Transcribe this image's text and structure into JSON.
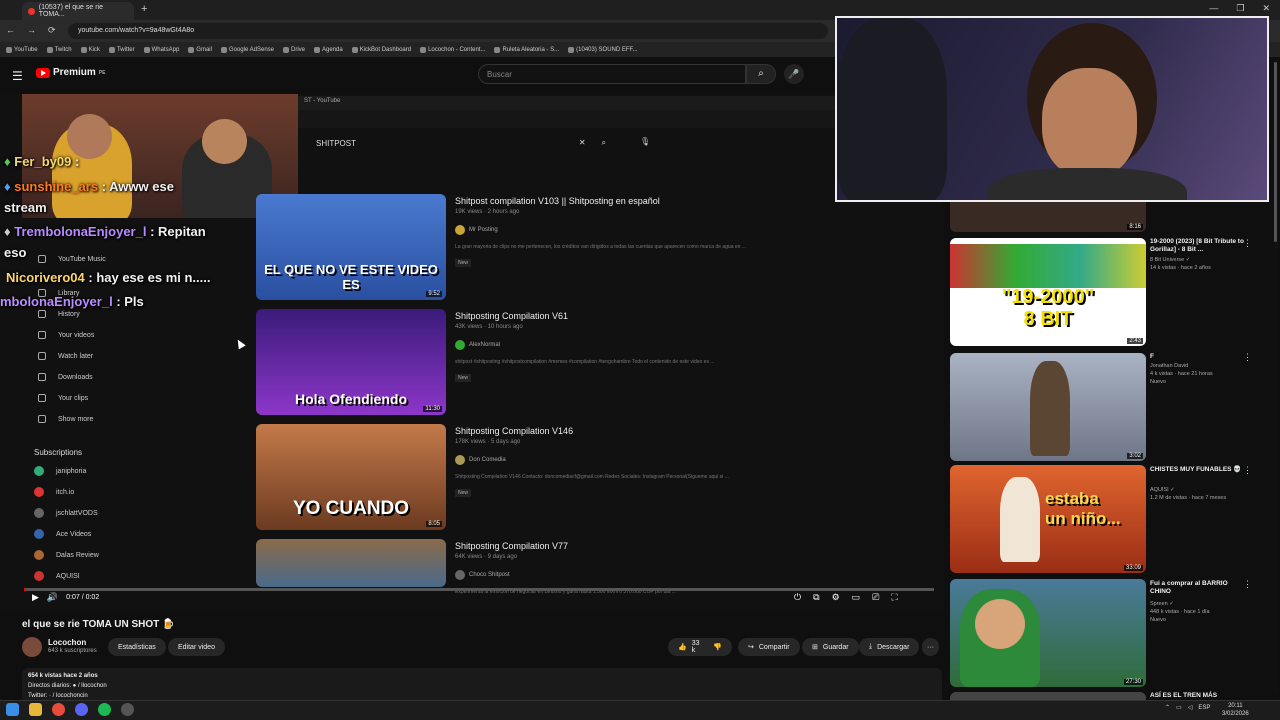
{
  "browser": {
    "tab_title": "(10537) el que se rie TOMA...",
    "new_tab": "+",
    "window_controls": [
      "—",
      "❐",
      "✕"
    ],
    "nav": [
      "←",
      "→",
      "⟳"
    ],
    "url": "youtube.com/watch?v=9a48wGt4A8o",
    "bookmarks": [
      "YouTube",
      "Twitch",
      "Kick",
      "Twitter",
      "WhatsApp",
      "Gmail",
      "Google AdSense",
      "Drive",
      "Agenda",
      "KickBot Dashboard",
      "Locochon - Content...",
      "Ruleta Aleatoria - S...",
      "(10403) SOUND EFF..."
    ]
  },
  "youtube": {
    "menu_icon": "☰",
    "logo": "Premium",
    "logo_sup": "PE",
    "search_placeholder": "Buscar",
    "search_icon": "⌕",
    "mic_icon": "🎤"
  },
  "inner": {
    "tab": "ST - YouTube",
    "search_query": "SHITPOST",
    "search_clear": "✕",
    "search_icon": "⌕",
    "mic_icon": "🎙",
    "menu_items": [
      "YouTube Music",
      "Library",
      "History",
      "Your videos",
      "Watch later",
      "Downloads",
      "Your clips",
      "Show more"
    ],
    "subs_header": "Subscriptions",
    "subs": [
      "janiphoria",
      "itch.io",
      "jschlattVODS",
      "Ace Videos",
      "Dalas Review",
      "AQUISI"
    ],
    "results": [
      {
        "title": "Shitpost compilation V103 || Shitposting en español",
        "meta": "19K views · 2 hours ago",
        "channel": "Mr Posting",
        "desc": "La gran mayoria de clips no me pertenecen, los créditos van dirigidos a todas las cuentas que aparecen como marca de agua en ...",
        "badge": "New",
        "thumb_text": "EL QUE NO VE ESTE VIDEO ES",
        "duration": "9:52"
      },
      {
        "title": "Shitposting Compilation V61",
        "meta": "43K views · 10 hours ago",
        "channel": "AlexNormal",
        "desc": "shitpost #shitposting #shitpostcompilation #memes #compilation #tengohambre Todo el contenido de este video es ...",
        "badge": "New",
        "thumb_text": "Hola Ofendiendo",
        "duration": "11:30"
      },
      {
        "title": "Shitposting Compilation V146",
        "meta": "178K views · 5 days ago",
        "channel": "Don Comedia",
        "desc": "Shitposting Compilation V146 Contacto: doncomediacf@gmail.com Redes Sociales: Instagram Personal(Sigueme aqui si ...",
        "badge": "New",
        "thumb_text": "YO CUANDO",
        "duration": "8:05"
      },
      {
        "title": "Shitposting Compilation V77",
        "meta": "64K views · 9 days ago",
        "channel": "Choco Shitpost",
        "desc": "Experimenta la emoción de negociar en Binomo y gana hasta 1.500 MXN o 370.000 COP por dia ...",
        "badge": "",
        "thumb_text": "",
        "duration": ""
      }
    ]
  },
  "chat": [
    {
      "user": "Fer_by09",
      "msg": " : ",
      "color": "#f5d76e"
    },
    {
      "user": "sunshine_ars",
      "msg": " : Awww ese",
      "color": "#ff7a1a"
    },
    {
      "user": "",
      "msg": "stream",
      "color": "#ffffff"
    },
    {
      "user": "TrembolonaEnjoyer_l",
      "msg": " : Repitan",
      "color": "#b98cff"
    },
    {
      "user": "",
      "msg": "eso",
      "color": "#ffffff"
    },
    {
      "user": "Nicorivero04",
      "msg": " : hay ese es mi n.....",
      "color": "#ffd56b"
    },
    {
      "user": "mbolonaEnjoyer_l",
      "msg": " : Pls",
      "color": "#b98cff"
    }
  ],
  "player": {
    "progress": 0.0,
    "time": "0:07 / 0:02",
    "play_icon": "▶",
    "volume_icon": "🔊",
    "right_icons": [
      "⏻",
      "⧉",
      "⚙",
      "▭",
      "⎚",
      "⛶"
    ]
  },
  "video": {
    "title": "el que se rie TOMA UN SHOT 🍺",
    "channel": "Locochon",
    "subs": "643 k suscriptores",
    "btn_stats": "Estadísticas",
    "btn_edit": "Editar video",
    "likes": "33 k",
    "share": "Compartir",
    "save": "Guardar",
    "download": "Descargar",
    "more": "···",
    "desc_line1": "654 k vistas  hace 2 años",
    "desc_line2": "Directos diarios: ● / llocochon",
    "desc_line3": "Twitter: · / locochoncin"
  },
  "sidebar": [
    {
      "title": "",
      "meta": "",
      "duration": "8:16",
      "color": "#3a2a24"
    },
    {
      "title": "19-2000 (2023) [8 Bit Tribute to Gorillaz] - 8 Bit ...",
      "meta": "8 Bit Universe ✓\n14 k vistas · hace 2 años",
      "duration": "2:43",
      "thumb_text": "\"19-2000\"\n8 BIT",
      "color": "#ffffff"
    },
    {
      "title": "F",
      "meta": "Jonathan David\n4 k vistas · hace 21 horas\nNuevo",
      "duration": "3:02",
      "thumb_text": "",
      "color": "#8a93a6"
    },
    {
      "title": "CHISTES MUY FUNABLES 💀",
      "meta": "AQUISI ✓\n1.2 M de vistas · hace 7 meses",
      "duration": "33:09",
      "thumb_text": "estaba\nun niño...",
      "color": "#c8451f"
    },
    {
      "title": "Fui a comprar al BARRIO CHINO",
      "meta": "Spreen ✓\n448 k vistas · hace 1 día\nNuevo",
      "duration": "27:30",
      "thumb_text": "",
      "color": "#2f6b3a"
    },
    {
      "title": "ASÍ ES EL TREN MÁS",
      "meta": "",
      "duration": "",
      "thumb_text": "",
      "color": "#444"
    }
  ],
  "taskbar": {
    "lang": "ESP",
    "time": "20:11",
    "date": "3/02/2026"
  }
}
